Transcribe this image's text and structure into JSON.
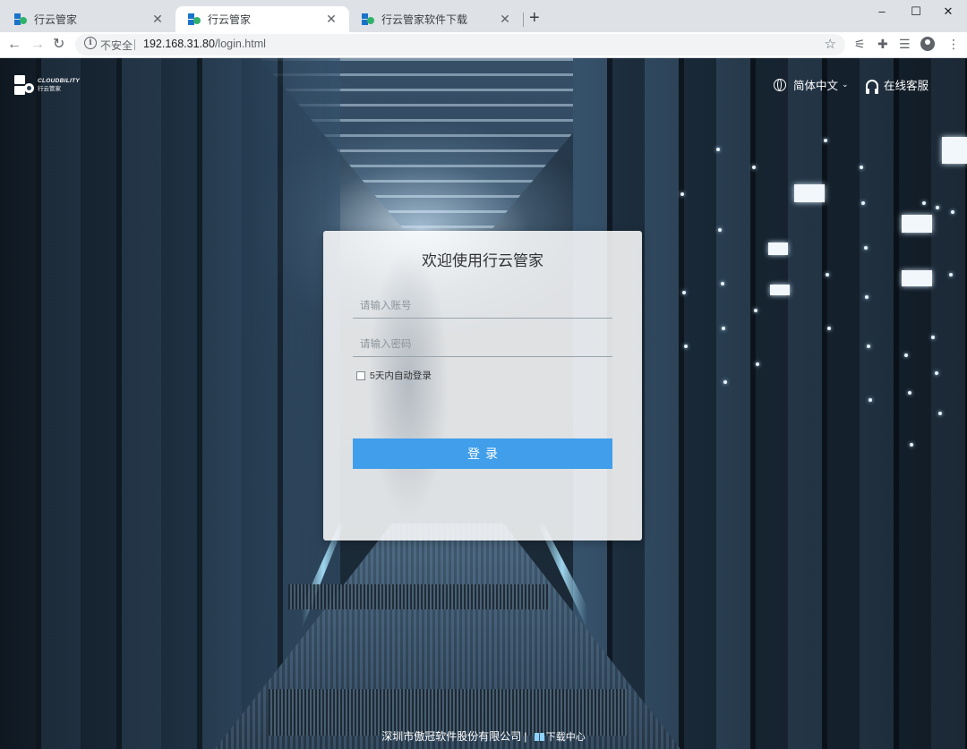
{
  "browser": {
    "tabs": [
      {
        "label": "行云管家",
        "active": false
      },
      {
        "label": "行云管家",
        "active": true
      },
      {
        "label": "行云管家软件下载",
        "active": false
      }
    ],
    "new_tab": "+",
    "window_controls": {
      "minimize": "–",
      "maximize": "☐",
      "close": "✕"
    },
    "nav": {
      "back": "←",
      "forward": "→",
      "reload": "↻"
    },
    "address": {
      "security_text": "不安全",
      "host": "192.168.31.80",
      "path": "/login.html"
    }
  },
  "brand": {
    "name_en": "CLOUDBILITY",
    "name_cn": "行云管家",
    "icon": "cloudbility-logo"
  },
  "header": {
    "language": "简体中文",
    "support": "在线客服"
  },
  "login": {
    "title": "欢迎使用行云管家",
    "account_placeholder": "请输入账号",
    "password_placeholder": "请输入密码",
    "remember_label": "5天内自动登录",
    "remember_checked": false,
    "submit_label": "登录"
  },
  "footer": {
    "company": "深圳市傲冠软件股份有限公司",
    "separator": "|",
    "download_label": "下载中心"
  },
  "colors": {
    "primary_button": "#409eea",
    "tabstrip": "#dee1e6"
  }
}
